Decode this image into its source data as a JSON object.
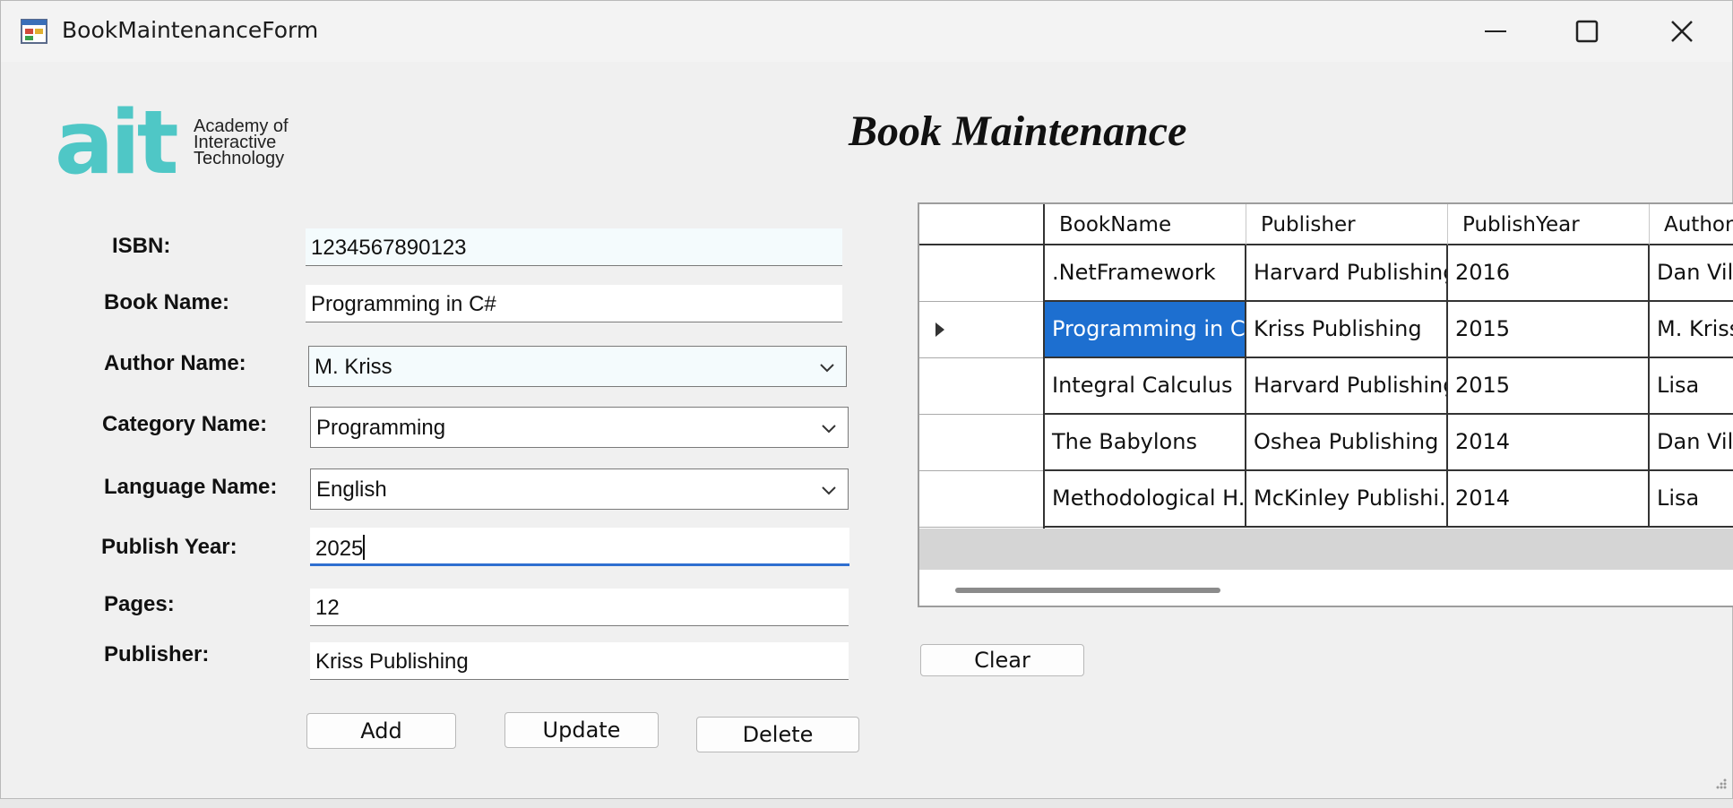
{
  "window": {
    "title": "BookMaintenanceForm"
  },
  "logo": {
    "mark": "ait",
    "line1": "Academy of",
    "line2": "Interactive",
    "line3": "Technology"
  },
  "page_title": "Book Maintenance",
  "form": {
    "isbn_label": "ISBN:",
    "isbn_value": "1234567890123",
    "book_name_label": "Book Name:",
    "book_name_value": "Programming in C#",
    "author_label": "Author Name:",
    "author_value": "M. Kriss",
    "category_label": "Category Name:",
    "category_value": "Programming",
    "language_label": "Language Name:",
    "language_value": "English",
    "publish_year_label": "Publish Year:",
    "publish_year_value": "2025",
    "pages_label": "Pages:",
    "pages_value": "12",
    "publisher_label": "Publisher:",
    "publisher_value": "Kriss Publishing"
  },
  "buttons": {
    "add": "Add",
    "update": "Update",
    "delete": "Delete",
    "clear": "Clear"
  },
  "grid": {
    "columns": [
      "BookName",
      "Publisher",
      "PublishYear",
      "Author"
    ],
    "rows": [
      [
        ".NetFramework",
        "Harvard Publishing",
        "2016",
        "Dan Vill"
      ],
      [
        "Programming in C#",
        "Kriss Publishing",
        "2015",
        "M. Kriss"
      ],
      [
        "Integral Calculus",
        "Harvard Publishing",
        "2015",
        "Lisa"
      ],
      [
        "The Babylons",
        "Oshea Publishing",
        "2014",
        "Dan Vill"
      ],
      [
        "Methodological H...",
        "McKinley Publishi...",
        "2014",
        "Lisa"
      ]
    ],
    "selected_row": 1
  }
}
